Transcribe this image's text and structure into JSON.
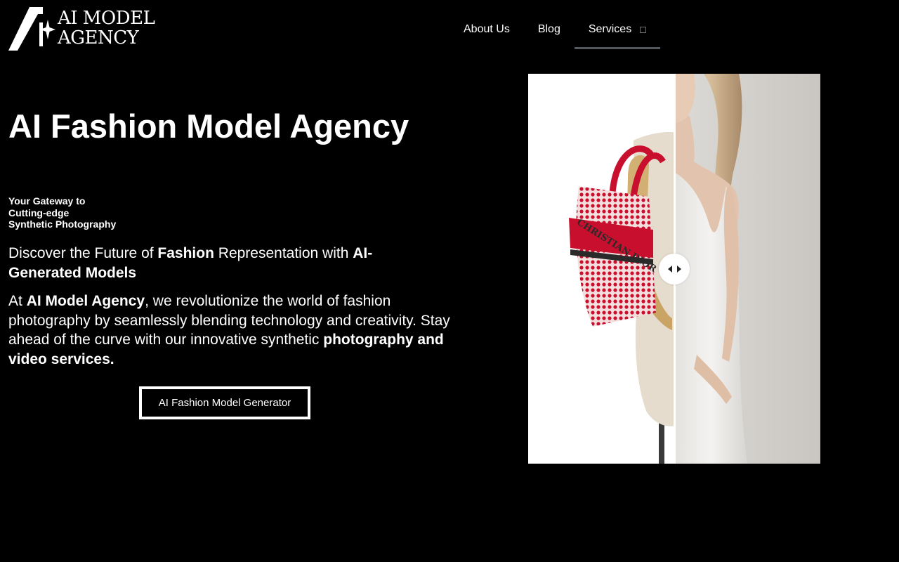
{
  "brand": {
    "logo_line1": "AI MODEL",
    "logo_line2": "AGENCY"
  },
  "nav": {
    "items": [
      {
        "label": "About Us"
      },
      {
        "label": "Blog"
      },
      {
        "label": "Services"
      }
    ]
  },
  "hero": {
    "title": "AI Fashion Model Agency",
    "tagline": [
      "Your Gateway to",
      "Cutting-edge",
      "Synthetic Photography"
    ],
    "lede": {
      "part1": "Discover the Future of ",
      "bold1": "Fashion",
      "part2": " Representation with ",
      "bold2": "AI-Generated Models"
    },
    "body": {
      "part1": "At ",
      "bold1": "AI Model Agency",
      "part2": ", we revolutionize the world of fashion photography by seamlessly blending technology and creativity. Stay ahead of the curve with our innovative synthetic ",
      "bold2": "photography and video services."
    },
    "cta_label": "AI Fashion Model Generator"
  },
  "compare": {
    "before_bag_text": "CHRISTIAN DIOR",
    "handle_icon": "left-right-arrows-icon"
  },
  "colors": {
    "background": "#000000",
    "text": "#ffffff",
    "nav_underline": "#54595f",
    "bag_red": "#c8102e"
  }
}
